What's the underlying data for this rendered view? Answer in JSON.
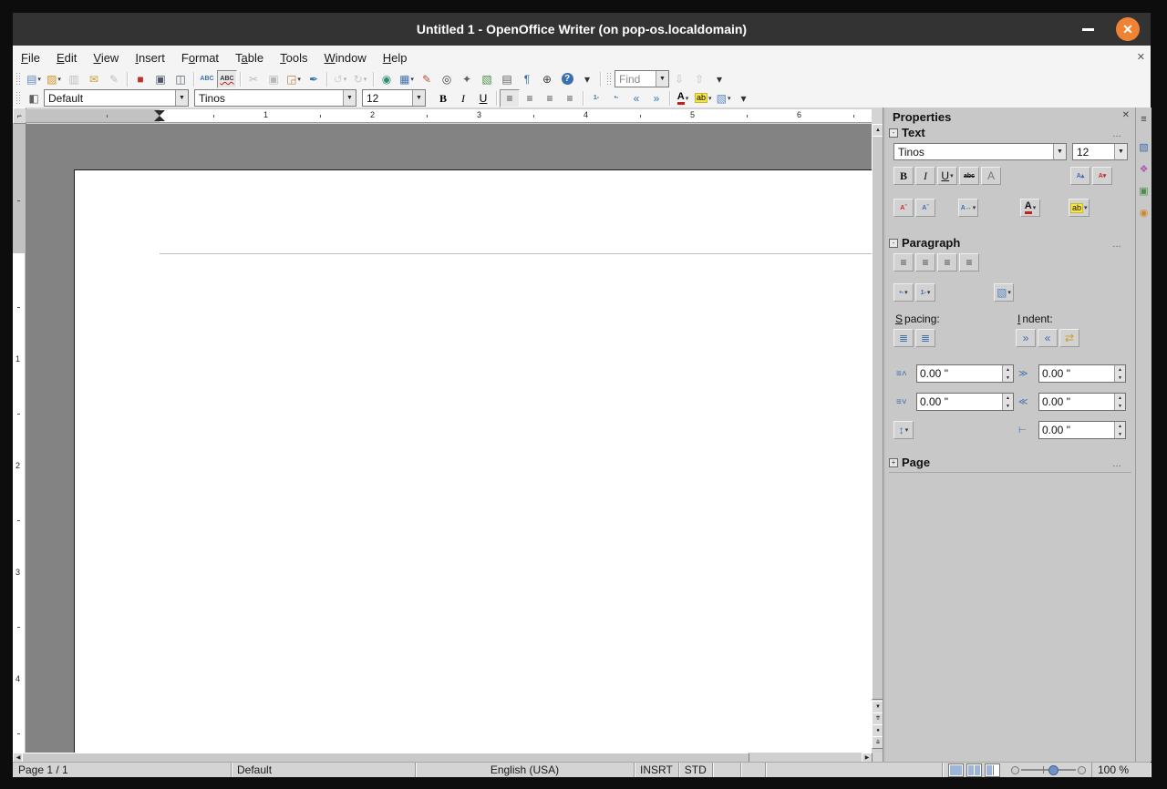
{
  "window": {
    "title": "Untitled 1 - OpenOffice Writer (on pop-os.localdomain)"
  },
  "menubar": {
    "items": [
      {
        "name": "file",
        "pre": "",
        "key": "F",
        "post": "ile"
      },
      {
        "name": "edit",
        "pre": "",
        "key": "E",
        "post": "dit"
      },
      {
        "name": "view",
        "pre": "",
        "key": "V",
        "post": "iew"
      },
      {
        "name": "insert",
        "pre": "",
        "key": "I",
        "post": "nsert"
      },
      {
        "name": "format",
        "pre": "F",
        "key": "o",
        "post": "rmat"
      },
      {
        "name": "table",
        "pre": "T",
        "key": "a",
        "post": "ble"
      },
      {
        "name": "tools",
        "pre": "",
        "key": "T",
        "post": "ools"
      },
      {
        "name": "window",
        "pre": "",
        "key": "W",
        "post": "indow"
      },
      {
        "name": "help",
        "pre": "",
        "key": "H",
        "post": "elp"
      }
    ],
    "close_doc_icon": "✕"
  },
  "toolbar_standard": {
    "buttons": [
      {
        "name": "new-document-icon",
        "g": "▤",
        "fg": "#5b87c5",
        "dd": true
      },
      {
        "name": "open-icon",
        "g": "▨",
        "fg": "#d89028",
        "dd": true
      },
      {
        "name": "save-icon",
        "g": "▥",
        "fg": "#666666",
        "d": true
      },
      {
        "name": "document-as-email-icon",
        "g": "✉",
        "fg": "#c8a030"
      },
      {
        "name": "edit-file-icon",
        "g": "✎",
        "fg": "#666666",
        "d": true
      },
      {
        "sep": true
      },
      {
        "name": "export-pdf-icon",
        "g": "■",
        "fg": "#c03028"
      },
      {
        "name": "print-icon",
        "g": "▣",
        "fg": "#505868"
      },
      {
        "name": "page-preview-icon",
        "g": "◫",
        "fg": "#505868"
      },
      {
        "sep": true
      },
      {
        "name": "spellcheck-icon",
        "g": "ABC",
        "fg": "#3a6fb0",
        "cls": "sm"
      },
      {
        "name": "autospellcheck-icon",
        "g": "ABC",
        "fg": "#333333",
        "cls": "sm rsq",
        "sel": true
      },
      {
        "sep": true
      },
      {
        "name": "cut-icon",
        "g": "✂",
        "fg": "#555555",
        "d": true
      },
      {
        "name": "copy-icon",
        "g": "▣",
        "fg": "#555555",
        "d": true
      },
      {
        "name": "paste-icon",
        "g": "◲",
        "fg": "#b5813f",
        "dd": true
      },
      {
        "name": "format-paintbrush-icon",
        "g": "✒",
        "fg": "#3a6fb0"
      },
      {
        "sep": true
      },
      {
        "name": "undo-icon",
        "g": "↺",
        "fg": "#c8a030",
        "d": true,
        "dd": true
      },
      {
        "name": "redo-icon",
        "g": "↻",
        "fg": "#4a8f4a",
        "d": true,
        "dd": true
      },
      {
        "sep": true
      },
      {
        "name": "hyperlink-icon",
        "g": "◉",
        "fg": "#2e8b74"
      },
      {
        "name": "table-icon",
        "g": "▦",
        "fg": "#3a6fb0",
        "dd": true
      },
      {
        "name": "draw-functions-icon",
        "g": "✎",
        "fg": "#b05a2f"
      },
      {
        "name": "find-replace-icon",
        "g": "◎",
        "fg": "#404040"
      },
      {
        "name": "navigator-icon",
        "g": "✦",
        "fg": "#606060"
      },
      {
        "name": "gallery-icon",
        "g": "▧",
        "fg": "#4a8f4a"
      },
      {
        "name": "data-sources-icon",
        "g": "▤",
        "fg": "#606060"
      },
      {
        "name": "nonprinting-characters-icon",
        "g": "¶",
        "fg": "#3a6fb0"
      },
      {
        "name": "zoom-icon",
        "g": "⊕",
        "fg": "#404040"
      },
      {
        "name": "help-icon",
        "g": "?",
        "cls": "circ"
      },
      {
        "name": "toolbar-overflow-icon",
        "g": "▾",
        "fg": "#333333"
      }
    ],
    "find": {
      "placeholder": "Find"
    },
    "find_buttons": [
      {
        "name": "find-next-icon",
        "g": "⇩",
        "fg": "#3a6fb0",
        "d": true
      },
      {
        "name": "find-previous-icon",
        "g": "⇧",
        "fg": "#3a6fb0",
        "d": true
      },
      {
        "name": "find-overflow-icon",
        "g": "▾",
        "fg": "#333333"
      }
    ]
  },
  "toolbar_formatting": {
    "style_value": "Default",
    "font_value": "Tinos",
    "size_value": "12",
    "style_dialog_icon": {
      "name": "styles-dialog-icon",
      "g": "◧",
      "fg": "#606060"
    },
    "buttons": [
      {
        "name": "bold-icon",
        "g": "B",
        "cls": "bold"
      },
      {
        "name": "italic-icon",
        "g": "I",
        "cls": "ital"
      },
      {
        "name": "underline-icon",
        "g": "U",
        "cls": "und"
      },
      {
        "sep": true
      },
      {
        "name": "align-left-icon",
        "g": "≡",
        "fg": "#444444",
        "sel": true
      },
      {
        "name": "align-center-icon",
        "g": "≡",
        "fg": "#444444"
      },
      {
        "name": "align-right-icon",
        "g": "≡",
        "fg": "#444444"
      },
      {
        "name": "align-justify-icon",
        "g": "≡",
        "fg": "#444444"
      },
      {
        "sep": true
      },
      {
        "name": "numbered-list-icon",
        "g": "1-",
        "fg": "#3a6fb0",
        "cls": "sm"
      },
      {
        "name": "bullet-list-icon",
        "g": "•-",
        "fg": "#3a6fb0",
        "cls": "sm"
      },
      {
        "name": "decrease-indent-icon",
        "g": "«",
        "fg": "#3a6fb0"
      },
      {
        "name": "increase-indent-icon",
        "g": "»",
        "fg": "#3a6fb0"
      },
      {
        "sep": true
      },
      {
        "name": "font-color-icon",
        "g": "A",
        "cls": "fc",
        "dd": true
      },
      {
        "name": "highlighting-icon",
        "g": "ab",
        "cls": "hl",
        "dd": true
      },
      {
        "name": "paragraph-background-icon",
        "g": "▧",
        "fg": "#5b87c5",
        "dd": true
      },
      {
        "name": "formatting-overflow-icon",
        "g": "▾",
        "fg": "#333333"
      }
    ]
  },
  "ruler_h": {
    "numbers": [
      1,
      2,
      3,
      4,
      5,
      6
    ]
  },
  "ruler_v": {
    "numbers": [
      1,
      2,
      3,
      4
    ]
  },
  "sidebar": {
    "title": "Properties",
    "close_icon": "✕",
    "text_section": {
      "title": "Text",
      "font_value": "Tinos",
      "size_value": "12",
      "row1": [
        {
          "name": "sb-bold-icon",
          "g": "B",
          "cls": "bold"
        },
        {
          "name": "sb-italic-icon",
          "g": "I",
          "cls": "ital"
        },
        {
          "name": "sb-underline-icon",
          "g": "U",
          "cls": "und",
          "dd": true
        },
        {
          "name": "sb-strikethrough-icon",
          "g": "abc",
          "cls": "sm strike"
        },
        {
          "name": "sb-shadow-icon",
          "g": "A",
          "fg": "#777777"
        }
      ],
      "row1_right": [
        {
          "name": "increase-font-icon",
          "g": "A▴",
          "fg": "#3a6fb0",
          "cls": "sm"
        },
        {
          "name": "decrease-font-icon",
          "g": "A▾",
          "fg": "#c03028",
          "cls": "sm"
        }
      ],
      "row2a": [
        {
          "name": "superscript-icon",
          "g": "Aˆ",
          "fg": "#c03028",
          "cls": "sm"
        },
        {
          "name": "subscript-icon",
          "g": "Aˇ",
          "fg": "#3a6fb0",
          "cls": "sm"
        }
      ],
      "row2b": [
        {
          "name": "character-spacing-icon",
          "g": "A↔",
          "fg": "#3a6fb0",
          "cls": "sm",
          "dd": true
        }
      ],
      "row2c": [
        {
          "name": "sb-font-color-icon",
          "g": "A",
          "cls": "fc",
          "dd": true
        }
      ],
      "row2d": [
        {
          "name": "sb-highlighting-icon",
          "g": "ab",
          "cls": "hl",
          "dd": true
        }
      ]
    },
    "paragraph_section": {
      "title": "Paragraph",
      "align": [
        {
          "name": "sb-align-left-icon",
          "g": "≡",
          "fg": "#444444"
        },
        {
          "name": "sb-align-center-icon",
          "g": "≡",
          "fg": "#444444"
        },
        {
          "name": "sb-align-right-icon",
          "g": "≡",
          "fg": "#444444"
        },
        {
          "name": "sb-align-justify-icon",
          "g": "≡",
          "fg": "#444444"
        }
      ],
      "lists": [
        {
          "name": "sb-bullet-list-icon",
          "g": "•-",
          "fg": "#3a6fb0",
          "cls": "sm",
          "dd": true
        },
        {
          "name": "sb-numbered-list-icon",
          "g": "1-",
          "fg": "#3a6fb0",
          "cls": "sm",
          "dd": true
        }
      ],
      "background": [
        {
          "name": "sb-paragraph-background-icon",
          "g": "▧",
          "fg": "#5b87c5",
          "dd": true
        }
      ],
      "spacing_label": {
        "pre": "",
        "key": "S",
        "post": "pacing:"
      },
      "indent_label": {
        "pre": "",
        "key": "I",
        "post": "ndent:"
      },
      "spacing_buttons": [
        {
          "name": "increase-spacing-icon",
          "g": "≣",
          "fg": "#3a6fb0"
        },
        {
          "name": "decrease-spacing-icon",
          "g": "≣",
          "fg": "#3a6fb0"
        }
      ],
      "indent_buttons": [
        {
          "name": "sb-increase-indent-icon",
          "g": "»",
          "fg": "#3a6fb0"
        },
        {
          "name": "sb-decrease-indent-icon",
          "g": "«",
          "fg": "#3a6fb0"
        },
        {
          "name": "switch-indent-icon",
          "g": "⇄",
          "fg": "#c8a030"
        }
      ],
      "above_spacing_value": "0.00 \"",
      "below_spacing_value": "0.00 \"",
      "before_indent_value": "0.00 \"",
      "after_indent_value": "0.00 \"",
      "firstline_indent_value": "0.00 \"",
      "line_spacing_button": [
        {
          "name": "line-spacing-icon",
          "g": "↕",
          "fg": "#3a6fb0",
          "dd": true
        }
      ]
    },
    "page_section": {
      "title": "Page"
    }
  },
  "tabbar": {
    "icons": [
      {
        "name": "sidebar-menu-icon",
        "g": "≡",
        "fg": "#333333"
      },
      {
        "name": "tab-properties-icon",
        "g": "▧",
        "fg": "#3a6fb0"
      },
      {
        "name": "tab-styles-icon",
        "g": "❖",
        "fg": "#b05ab0"
      },
      {
        "name": "tab-gallery-icon",
        "g": "▣",
        "fg": "#4a8f4a"
      },
      {
        "name": "tab-navigator-icon",
        "g": "◉",
        "fg": "#d2862a"
      }
    ]
  },
  "statusbar": {
    "page": "Page 1 / 1",
    "style": "Default",
    "language": "English (USA)",
    "insert_mode": "INSRT",
    "selection_mode": "STD",
    "zoom": "100 %"
  }
}
